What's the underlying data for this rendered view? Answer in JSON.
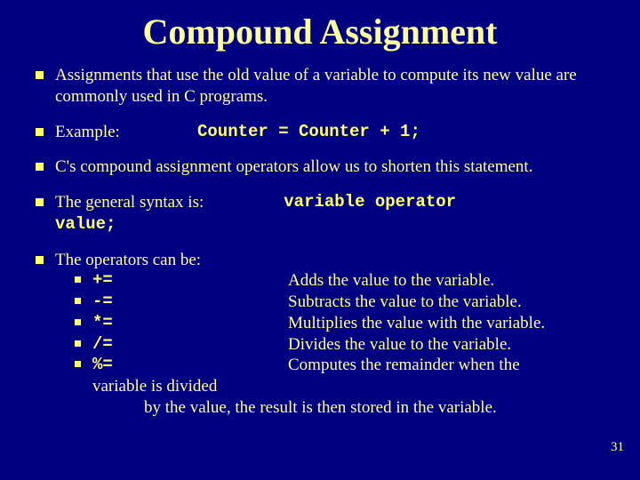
{
  "title": "Compound Assignment",
  "bullets": {
    "b1": "Assignments that use the old value of a variable to compute its new value are commonly used in C programs.",
    "b2_label": "Example:",
    "b2_code": "Counter = Counter + 1;",
    "b3": "C's compound assignment operators allow us to shorten this statement.",
    "b4_left": "The general syntax is:",
    "b4_code1": "variable operator",
    "b4_code2": "value;",
    "b5_lead": "The operators can be:"
  },
  "ops": [
    {
      "sym": "+=",
      "desc": "Adds the value to the variable."
    },
    {
      "sym": "-=",
      "desc": "Subtracts the value to the variable."
    },
    {
      "sym": "*=",
      "desc": "Multiplies the value with the variable."
    },
    {
      "sym": "/=",
      "desc": "Divides the value to the variable."
    },
    {
      "sym": "%=",
      "desc": "Computes the remainder when the"
    }
  ],
  "trail1": "variable is divided",
  "trail2": "by the value, the result is then stored in the variable.",
  "page_number": "31"
}
